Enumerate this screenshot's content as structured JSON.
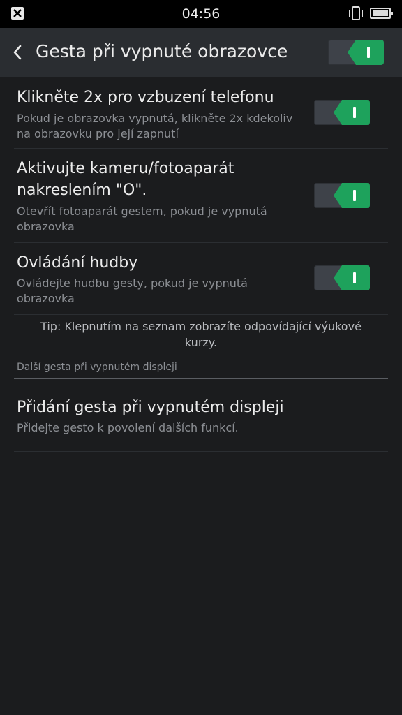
{
  "status_bar": {
    "time": "04:56",
    "left_icon": "close-box-icon",
    "signal_icon": "phone-vibrate-icon",
    "battery_icon": "battery-full-icon"
  },
  "app_bar": {
    "back_icon": "chevron-left-icon",
    "title": "Gesta při vypnuté obrazovce",
    "master_switch_on": true
  },
  "settings": [
    {
      "title": "Klikněte 2x pro vzbuzení telefonu",
      "subtitle_lines": [
        "Pokud je obrazovka vypnutá, klikněte 2x kdekoliv",
        "na obrazovku pro její zapnutí"
      ],
      "on": true
    },
    {
      "title_lines": [
        "Aktivujte kameru/fotoaparát",
        "nakreslením \"O\"."
      ],
      "subtitle_lines": [
        "Otevřít fotoaparát gestem, pokud je vypnutá",
        "obrazovka"
      ],
      "on": true
    },
    {
      "title": "Ovládání hudby",
      "subtitle_lines": [
        "Ovládejte hudbu gesty, pokud je vypnutá",
        "obrazovka"
      ],
      "on": true
    }
  ],
  "tip_lines": [
    "Tip: Klepnutím na seznam zobrazíte odpovídající výukové",
    "kurzy."
  ],
  "section_header": "Další gesta při vypnutém displeji",
  "add_gesture": {
    "title": "Přidání gesta při vypnutém displeji",
    "subtitle": "Přidejte gesto k povolení dalších funkcí."
  },
  "colors": {
    "background": "#1b1c1e",
    "app_bar": "#2a2d31",
    "switch_on": "#1ea25c"
  }
}
